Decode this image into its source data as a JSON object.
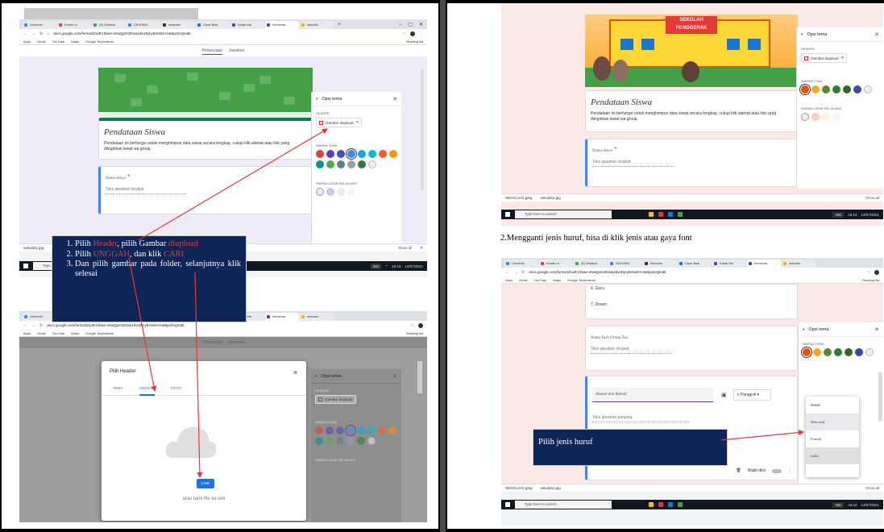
{
  "browser": {
    "tabs_left": [
      "Universit",
      "Konten ri",
      "(8) WhatsA",
      "DIKATAKI",
      "simbatm",
      "Case Basi",
      "Kotak Ma",
      "Informasi",
      "sekolah"
    ],
    "tabs_right": [
      "Universit",
      "Konten ri",
      "(8) WhatsA",
      "DIKATAKI",
      "simbatm",
      "Case Basi",
      "Kotak Ma",
      "Informasi",
      "sekolah"
    ],
    "url": "docs.google.com/forms/d/1aR1Skavi-sNaQpGIZNxw1bvxDjnybsNoDAHw6juXnQ/edit",
    "bookmarks": [
      "Apps",
      "Gmail",
      "YouTube",
      "Maps",
      "Google Terjemahan"
    ],
    "reading_list": "Reading list",
    "window_controls": [
      "–",
      "▢",
      "✕"
    ]
  },
  "form": {
    "tab_questions": "Pertanyaan",
    "tab_answers": "Jawaban",
    "title": "Pendataan Siswa",
    "description": "Pendataan ini berfungsi untuk menghimpun data siswa secara lengkap, cukup klik alamat atau link yang diinginkan lewat wa group",
    "q_name_label": "Nama Siswa",
    "q_name_required": "*",
    "short_answer": "Teks jawaban singkat",
    "long_answer": "Teks jawaban panjang",
    "q_place_label": "Nama Tulis Orang Tua",
    "q_address_label": "Alamat dan Rumah",
    "option_6": "6. Guru",
    "option_7": "7. Dosen",
    "paragraph": "Paragraf",
    "required_toggle": "Wajib diisi"
  },
  "theme_panel": {
    "title": "Opsi tema",
    "header_section": "HEADER",
    "header_chip": "Gambar diupload",
    "theme_color_section": "WARNA TEMA",
    "bg_color_section": "WARNA LATAR BELAKANG",
    "theme_colors": [
      "#db4437",
      "#673ab7",
      "#3f51b5",
      "#4285f4",
      "#03a9f4",
      "#00bcd4",
      "#ff5722",
      "#ff9800",
      "#009688",
      "#4caf50",
      "#607d8b",
      "#9e9e9e",
      "#2e7d32"
    ],
    "theme_colors_right": [
      "#e65100",
      "#f9a825",
      "#558b2f",
      "#2e7d32",
      "#33691e",
      "#3949ab"
    ]
  },
  "dialog": {
    "title": "Pilih Header",
    "tabs": [
      "TEMA",
      "UNGGAH",
      "FOTO"
    ],
    "button": "CARI",
    "drop_hint": "atau tarik file ke sini"
  },
  "font_menu": [
    "Dasar",
    "Dekoratif",
    "Formal",
    "Lucu"
  ],
  "banner": {
    "line1": "SEKOLAH",
    "line2": "PENGGERAK"
  },
  "download_bar": {
    "file1": "SEKOLAH1.jpeg",
    "file2": "sekolah1.jpg",
    "show_all": "Show all"
  },
  "taskbar": {
    "search": "Type here to search",
    "time": "18:15",
    "date": "14/07/2021",
    "time2": "18:14",
    "lang": "IND"
  },
  "callout1": {
    "step1_prefix": "Pilih ",
    "step1_red1": "Header",
    "step1_mid": ", pilih Gambar ",
    "step1_red2": "diupload",
    "step2_prefix": "Pilih ",
    "step2_red1": "UNGGAH",
    "step2_mid": ", dan klik ",
    "step2_red2": "CARI",
    "step3": "Dan pilih gambar pada folder, selanjutnya klik selesai"
  },
  "callout2": "Pilih jenis huruf",
  "caption2": "2.Mengganti jenis huruf, bisa di klik jenis atau gaya font"
}
